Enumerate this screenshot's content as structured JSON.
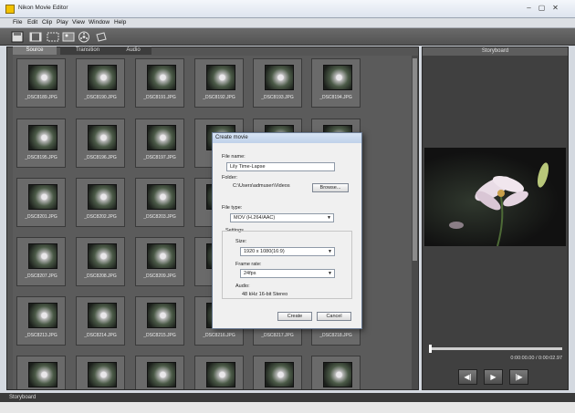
{
  "window": {
    "title": "Nikon Movie Editor",
    "controls": [
      "–",
      "▢",
      "✕"
    ]
  },
  "menu": [
    "File",
    "Edit",
    "Clip",
    "Play",
    "View",
    "Window",
    "Help"
  ],
  "toolbar_icons": [
    "save-icon",
    "add-clip-icon",
    "add-still-icon",
    "image-icon",
    "film-reel-icon",
    "export-icon"
  ],
  "tabs": {
    "source": "Source",
    "transition": "Transition",
    "audio": "Audio"
  },
  "thumbnails": [
    "_DSC8189.JPG",
    "_DSC8190.JPG",
    "_DSC8191.JPG",
    "_DSC8192.JPG",
    "_DSC8193.JPG",
    "_DSC8194.JPG",
    "_DSC8195.JPG",
    "_DSC8196.JPG",
    "_DSC8197.JPG",
    "",
    "",
    "",
    "_DSC8201.JPG",
    "_DSC8202.JPG",
    "_DSC8203.JPG",
    "",
    "",
    "",
    "_DSC8207.JPG",
    "_DSC8208.JPG",
    "_DSC8209.JPG",
    "",
    "",
    "",
    "_DSC8213.JPG",
    "_DSC8214.JPG",
    "_DSC8215.JPG",
    "_DSC8216.JPG",
    "_DSC8217.JPG",
    "_DSC8218.JPG",
    "",
    "",
    "",
    "",
    "",
    ""
  ],
  "storyboard": {
    "header": "Storyboard",
    "timecode": "0:00:00.00 / 0:00:02.97",
    "progress": 0.0,
    "buttons": {
      "prev": "◀|",
      "play": "▶",
      "next": "|▶"
    }
  },
  "status_bar": "Storyboard",
  "dialog": {
    "title": "Create movie",
    "file_name_label": "File name:",
    "file_name_value": "Lily Time-Lapse",
    "folder_label": "Folder:",
    "folder_value": "C:\\Users\\admuser\\Videos",
    "browse_button": "Browse...",
    "file_type_label": "File type:",
    "file_type_value": "MOV (H.264/AAC)",
    "settings_label": "Settings",
    "size_label": "Size:",
    "size_value": "1920 x 1080(16:9)",
    "frame_rate_label": "Frame rate:",
    "frame_rate_value": "24fps",
    "audio_label": "Audio:",
    "audio_value": "48 kHz 16-bit Stereo",
    "create_button": "Create",
    "cancel_button": "Cancel"
  }
}
